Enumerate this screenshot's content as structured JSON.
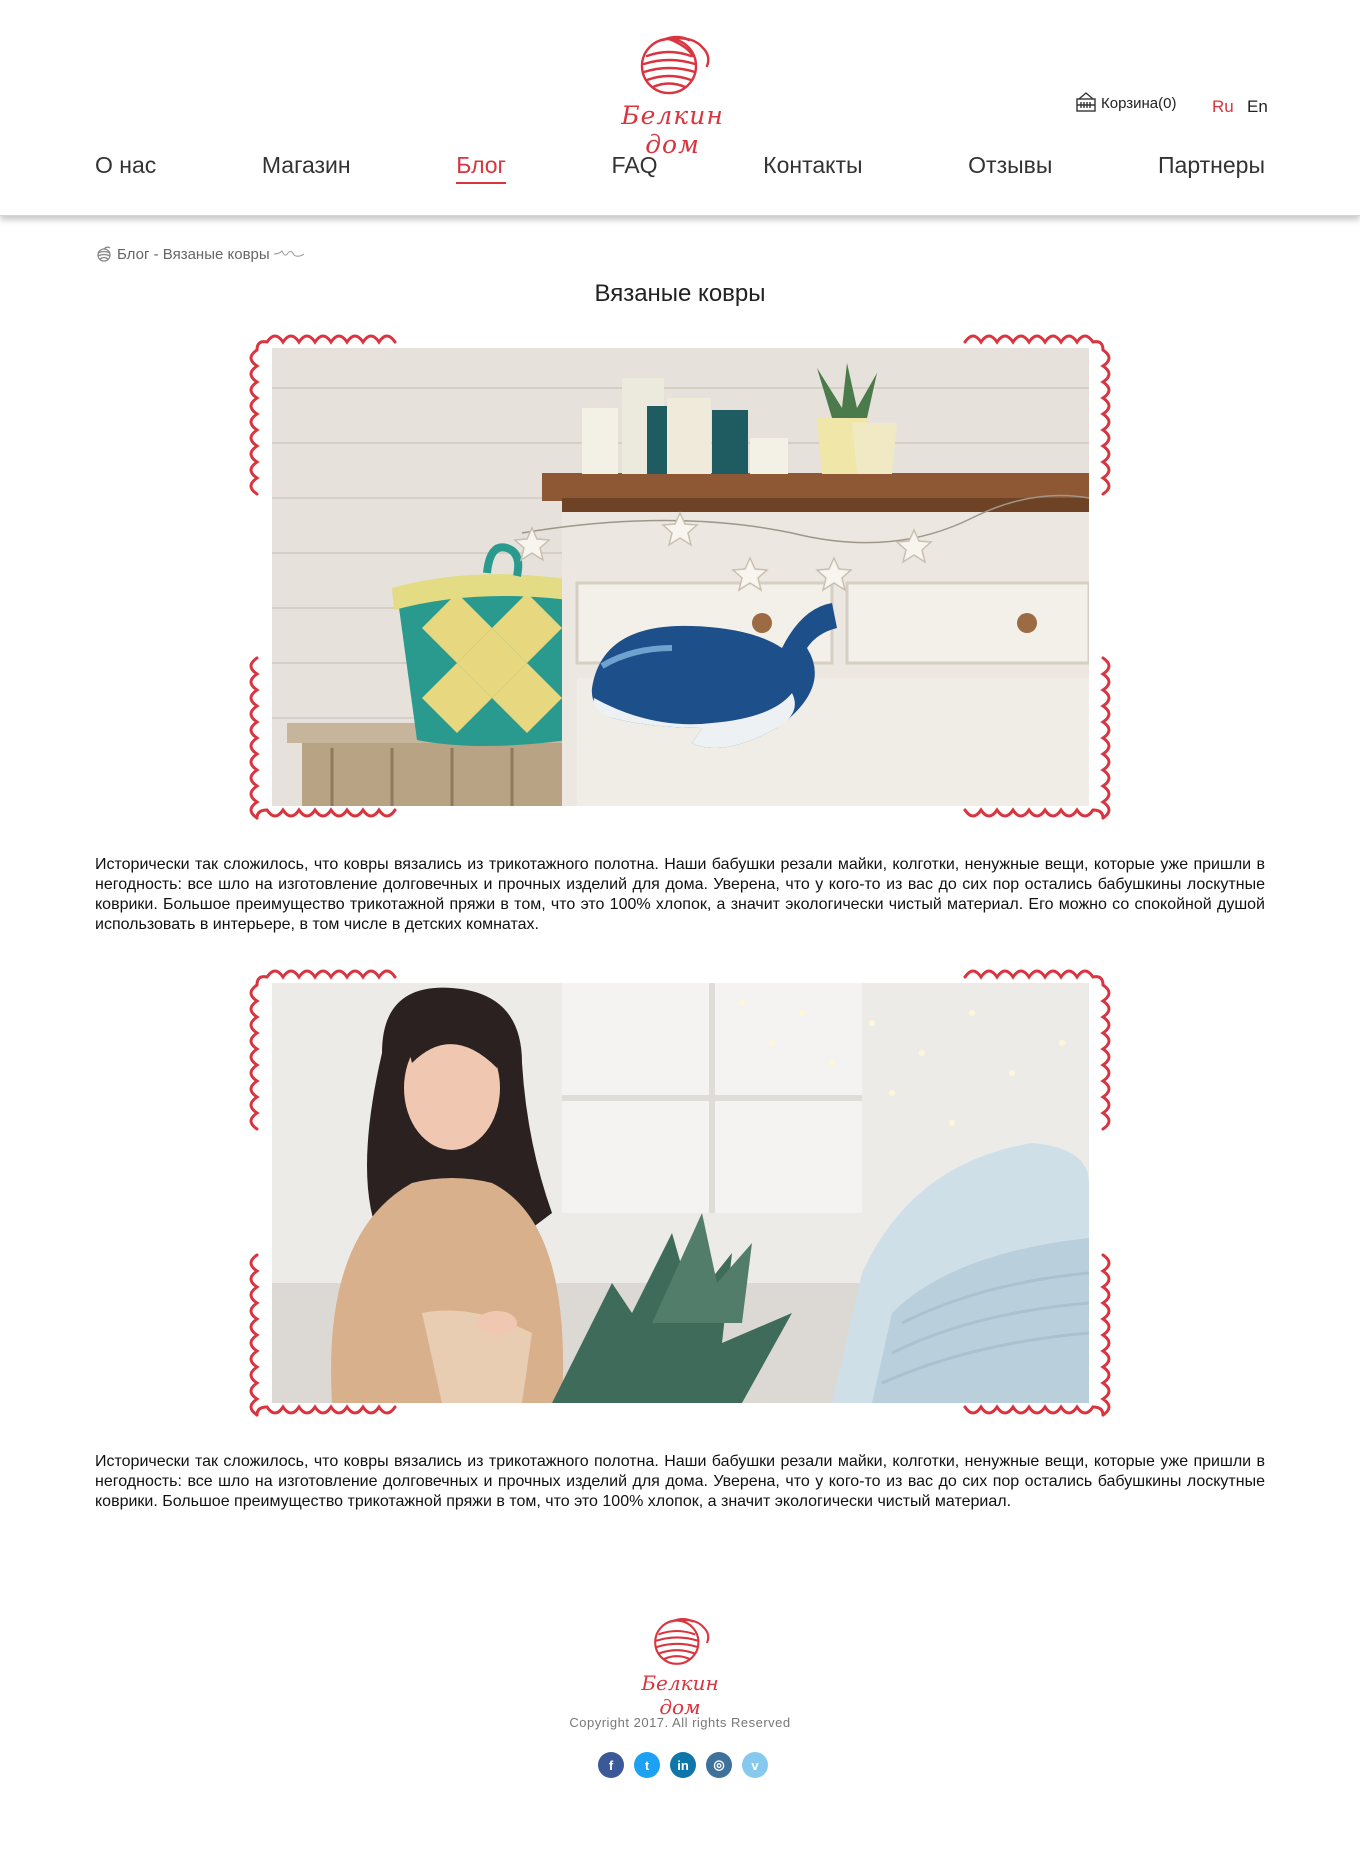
{
  "brand": {
    "name": "Белкин дом"
  },
  "header": {
    "cart_label": "Корзина(0)",
    "lang_ru": "Ru",
    "lang_en": "En",
    "nav": [
      {
        "label": "О нас"
      },
      {
        "label": "Магазин"
      },
      {
        "label": "Блог",
        "active": true
      },
      {
        "label": "FAQ"
      },
      {
        "label": "Контакты"
      },
      {
        "label": "Отзывы"
      },
      {
        "label": "Партнеры"
      }
    ]
  },
  "breadcrumb": {
    "text": "Блог - Вязаные ковры"
  },
  "article": {
    "title": "Вязаные ковры",
    "paragraph1": "Исторически так сложилось, что ковры вязались из трикотажного полотна. Наши бабушки резали майки, колготки, ненужные вещи, которые уже пришли в негодность: все шло на изготовление долговечных и прочных изделий для дома. Уверена, что у кого-то из вас до сих пор остались бабушкины лоскутные коврики. Большое преимущество трикотажной пряжи в том, что это 100% хлопок, а значит экологически чистый материал. Его можно со спокойной душой использовать в интерьере, в том числе в детских комнатах.",
    "paragraph2": "Исторически так сложилось, что ковры вязались из трикотажного полотна. Наши бабушки резали майки, колготки, ненужные вещи, которые уже пришли в негодность: все шло на изготовление долговечных и прочных изделий для дома. Уверена, что у кого-то из вас до сих пор остались бабушкины лоскутные коврики. Большое преимущество трикотажной пряжи в том, что это 100% хлопок, а значит экологически чистый материал."
  },
  "footer": {
    "copyright": "Copyright 2017. All rights Reserved",
    "social": [
      {
        "name": "facebook",
        "glyph": "f",
        "color": "#3b5998"
      },
      {
        "name": "twitter",
        "glyph": "t",
        "color": "#1da1f2"
      },
      {
        "name": "linkedin",
        "glyph": "in",
        "color": "#0e76a8"
      },
      {
        "name": "instagram",
        "glyph": "◎",
        "color": "#3f729b"
      },
      {
        "name": "vimeo",
        "glyph": "v",
        "color": "#86c9ef"
      }
    ]
  },
  "colors": {
    "accent": "#d9343f",
    "text": "#222222"
  }
}
